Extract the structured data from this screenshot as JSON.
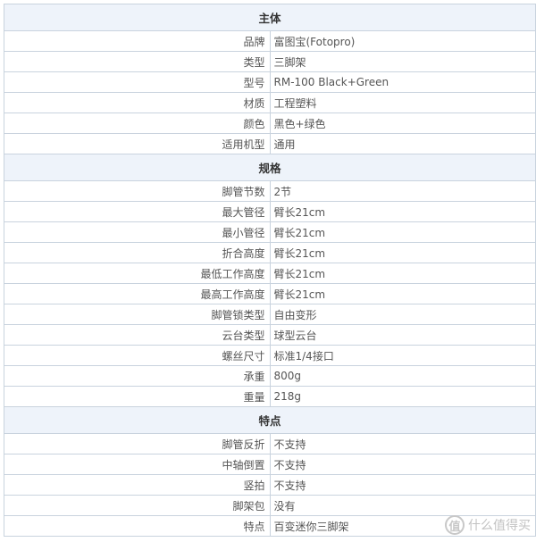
{
  "sections": [
    {
      "title": "主体",
      "rows": [
        {
          "label": "品牌",
          "value": "富图宝(Fotopro)"
        },
        {
          "label": "类型",
          "value": "三脚架"
        },
        {
          "label": "型号",
          "value": "RM-100 Black+Green"
        },
        {
          "label": "材质",
          "value": "工程塑料"
        },
        {
          "label": "颜色",
          "value": "黑色+绿色"
        },
        {
          "label": "适用机型",
          "value": "通用"
        }
      ]
    },
    {
      "title": "规格",
      "rows": [
        {
          "label": "脚管节数",
          "value": "2节"
        },
        {
          "label": "最大管径",
          "value": "臂长21cm"
        },
        {
          "label": "最小管径",
          "value": "臂长21cm"
        },
        {
          "label": "折合高度",
          "value": "臂长21cm"
        },
        {
          "label": "最低工作高度",
          "value": "臂长21cm"
        },
        {
          "label": "最高工作高度",
          "value": "臂长21cm"
        },
        {
          "label": "脚管锁类型",
          "value": "自由变形"
        },
        {
          "label": "云台类型",
          "value": "球型云台"
        },
        {
          "label": "螺丝尺寸",
          "value": "标准1/4接口"
        },
        {
          "label": "承重",
          "value": "800g"
        },
        {
          "label": "重量",
          "value": "218g"
        }
      ]
    },
    {
      "title": "特点",
      "rows": [
        {
          "label": "脚管反折",
          "value": "不支持"
        },
        {
          "label": "中轴倒置",
          "value": "不支持"
        },
        {
          "label": "竖拍",
          "value": "不支持"
        },
        {
          "label": "脚架包",
          "value": "没有"
        },
        {
          "label": "特点",
          "value": "百变迷你三脚架"
        }
      ]
    }
  ],
  "watermark": {
    "icon_glyph": "值",
    "icon_name": "smzdm-logo-icon",
    "text": "什么值得买"
  }
}
